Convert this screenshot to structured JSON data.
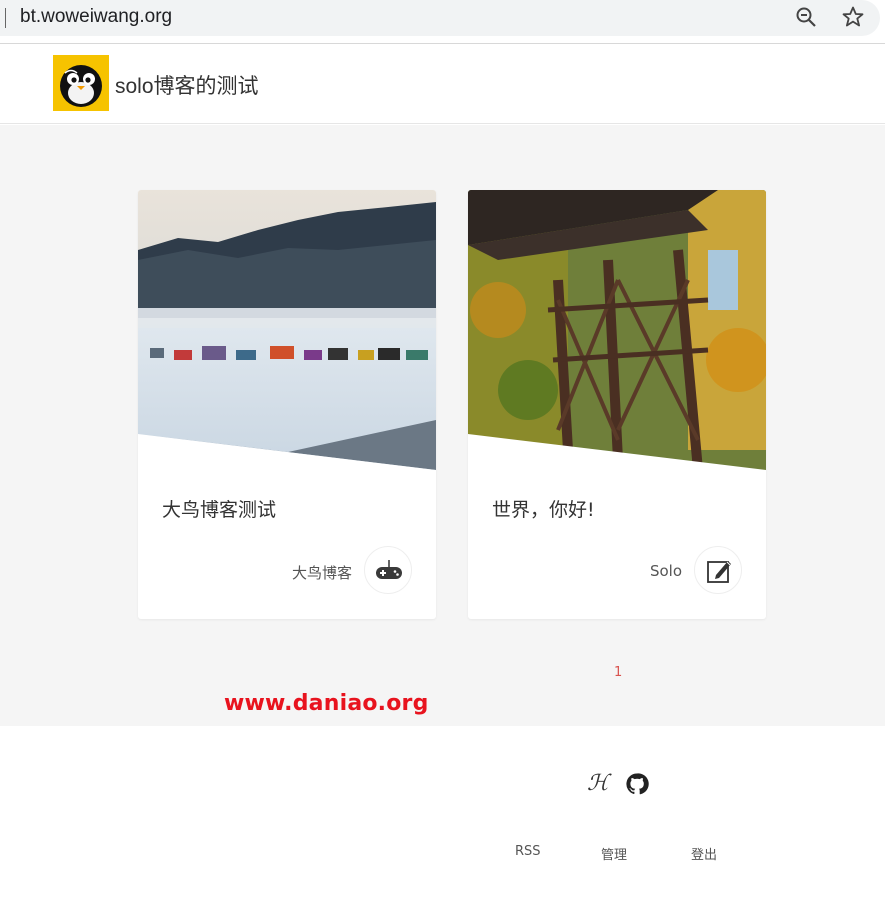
{
  "browser": {
    "url": "bt.woweiwang.org"
  },
  "header": {
    "site_title": "solo博客的测试"
  },
  "articles": [
    {
      "title": "大鸟博客测试",
      "author": "大鸟博客",
      "avatar_icon": "gamepad-icon"
    },
    {
      "title": "世界，你好!",
      "author": "Solo",
      "avatar_icon": "edit-icon"
    }
  ],
  "pagination": {
    "current": "1"
  },
  "watermark": "www.daniao.org",
  "footer": {
    "icons": [
      "hacpai-icon",
      "github-icon"
    ],
    "hacpai_glyph": "ℋ",
    "links": [
      "RSS",
      "管理",
      "登出"
    ]
  },
  "colors": {
    "pager": "#d9534f",
    "watermark": "#e8131e",
    "logo_bg": "#f6c300"
  }
}
